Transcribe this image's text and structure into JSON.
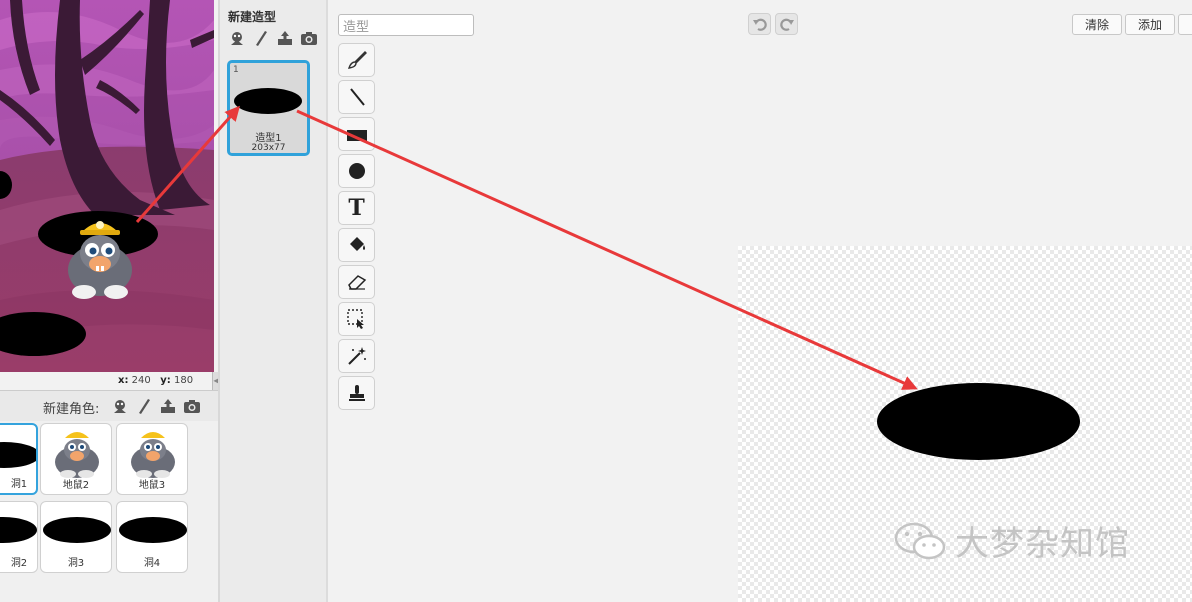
{
  "stage": {
    "x_label": "x:",
    "x_value": "240",
    "y_label": "y:",
    "y_value": "180"
  },
  "sprite_pane": {
    "new_sprite_label": "新建角色:",
    "header_icons": [
      "sprite-library-icon",
      "paint-brush-icon",
      "upload-icon",
      "camera-icon"
    ],
    "sprites": [
      {
        "name": "洞1",
        "kind": "hole",
        "selected": true
      },
      {
        "name": "地鼠2",
        "kind": "mole",
        "selected": false
      },
      {
        "name": "地鼠3",
        "kind": "mole",
        "selected": false
      },
      {
        "name": "洞2",
        "kind": "hole",
        "selected": false
      },
      {
        "name": "洞3",
        "kind": "hole",
        "selected": false
      },
      {
        "name": "洞4",
        "kind": "hole",
        "selected": false
      }
    ]
  },
  "costumes": {
    "new_costume_label": "新建造型",
    "header_icons": [
      "costume-library-icon",
      "paint-brush-icon",
      "upload-icon",
      "camera-icon"
    ],
    "items": [
      {
        "index": "1",
        "name": "造型1",
        "size": "203x77"
      }
    ]
  },
  "editor": {
    "costume_name_value": "造型",
    "undo_icon": "undo-icon",
    "redo_icon": "redo-icon",
    "clear_label": "清除",
    "add_label": "添加",
    "tools": [
      "brush-icon",
      "line-icon",
      "rectangle-icon",
      "ellipse-icon",
      "text-icon",
      "fill-bucket-icon",
      "eraser-icon",
      "select-icon",
      "magic-wand-icon",
      "stamp-icon"
    ],
    "text_tool_glyph": "T"
  },
  "watermark": {
    "text": "大梦杂知馆"
  },
  "colors": {
    "selection_blue": "#30a2da",
    "arrow_red": "#e8393a",
    "stage_purple": "#8e3d78"
  }
}
